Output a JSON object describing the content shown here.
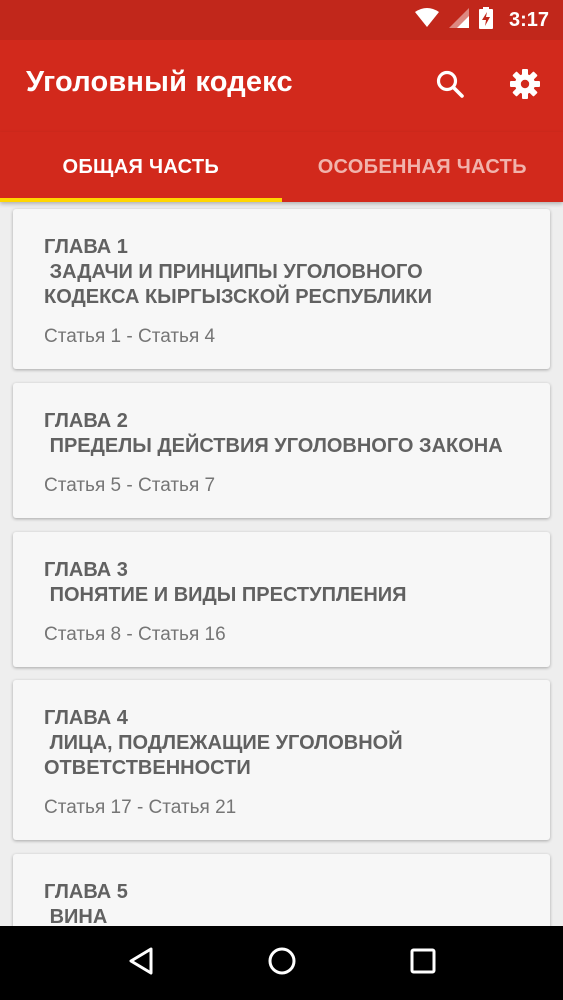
{
  "status_bar": {
    "time": "3:17"
  },
  "app_bar": {
    "title": "Уголовный кодекс",
    "actions": [
      "search-icon",
      "settings-icon"
    ],
    "color": "#d2291c"
  },
  "tabs": [
    {
      "label": "ОБЩАЯ ЧАСТЬ",
      "active": true
    },
    {
      "label": "ОСОБЕННАЯ ЧАСТЬ",
      "active": false
    }
  ],
  "chapters": [
    {
      "chapter": "ГЛАВА 1",
      "title": " ЗАДАЧИ И ПРИНЦИПЫ УГОЛОВНОГО\nКОДЕКСА КЫРГЫЗСКОЙ РЕСПУБЛИКИ",
      "range": "Статья 1 - Статья 4"
    },
    {
      "chapter": "ГЛАВА 2",
      "title": " ПРЕДЕЛЫ ДЕЙСТВИЯ УГОЛОВНОГО ЗАКОНА",
      "range": "Статья 5 - Статья 7"
    },
    {
      "chapter": "ГЛАВА 3",
      "title": " ПОНЯТИЕ И ВИДЫ ПРЕСТУПЛЕНИЯ",
      "range": "Статья 8 - Статья 16"
    },
    {
      "chapter": "ГЛАВА 4",
      "title": " ЛИЦА, ПОДЛЕЖАЩИЕ УГОЛОВНОЙ\nОТВЕТСТВЕННОСТИ",
      "range": "Статья 17 - Статья 21"
    },
    {
      "chapter": "ГЛАВА 5",
      "title": " ВИНА",
      "range": ""
    }
  ],
  "nav_bar": [
    "back-icon",
    "home-icon",
    "recents-icon"
  ]
}
